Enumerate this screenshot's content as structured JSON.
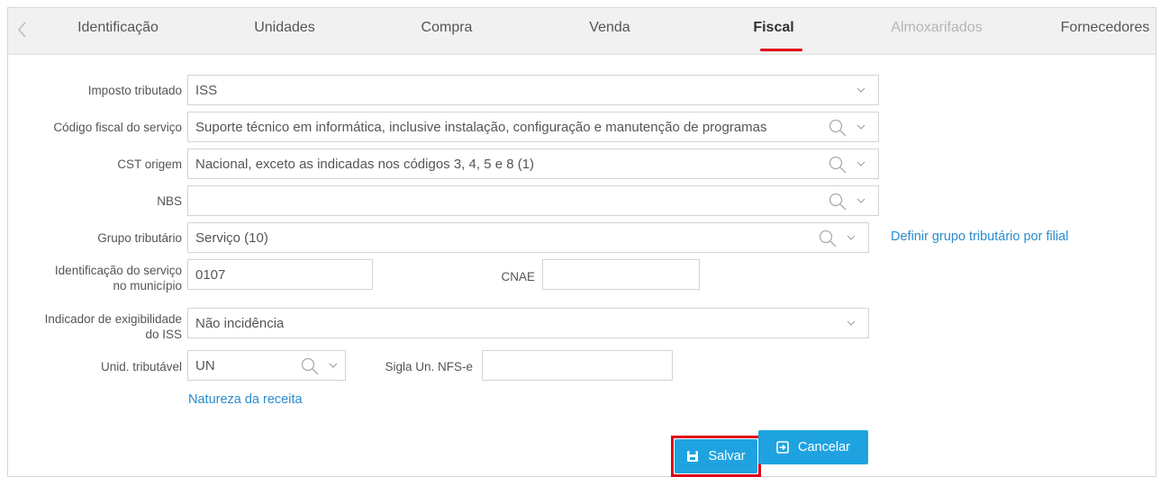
{
  "tabs": [
    {
      "label": "Identificação",
      "state": "normal"
    },
    {
      "label": "Unidades",
      "state": "normal"
    },
    {
      "label": "Compra",
      "state": "normal"
    },
    {
      "label": "Venda",
      "state": "normal"
    },
    {
      "label": "Fiscal",
      "state": "active"
    },
    {
      "label": "Almoxarifados",
      "state": "disabled"
    },
    {
      "label": "Fornecedores",
      "state": "normal"
    }
  ],
  "form": {
    "imposto": {
      "label": "Imposto tributado",
      "value": "ISS"
    },
    "codigo_fiscal": {
      "label": "Código fiscal do serviço",
      "value": "Suporte técnico em informática, inclusive instalação, configuração e manutenção de programas"
    },
    "cst": {
      "label": "CST origem",
      "value": "Nacional, exceto as indicadas nos códigos 3, 4, 5 e 8 (1)"
    },
    "nbs": {
      "label": "NBS",
      "value": ""
    },
    "grupo": {
      "label": "Grupo tributário",
      "value": "Serviço (10)",
      "link": "Definir grupo tributário por filial"
    },
    "identificacao": {
      "label_line1": "Identificação do serviço",
      "label_line2": "no município",
      "value": "0107"
    },
    "cnae": {
      "label": "CNAE",
      "value": ""
    },
    "exigibilidade": {
      "label_line1": "Indicador de exigibilidade",
      "label_line2": "do ISS",
      "value": "Não incidência"
    },
    "unid": {
      "label": "Unid. tributável",
      "value": "UN"
    },
    "sigla": {
      "label": "Sigla Un. NFS-e",
      "value": ""
    },
    "natureza_link": "Natureza da receita"
  },
  "buttons": {
    "save": "Salvar",
    "cancel": "Cancelar"
  },
  "colors": {
    "accent": "#1fa3e0",
    "highlight": "#e0001a",
    "link": "#2a8ccd"
  },
  "icons": {
    "search": "search-icon",
    "dropdown": "chevron-down-icon",
    "save": "save-icon",
    "cancel": "exit-icon"
  }
}
